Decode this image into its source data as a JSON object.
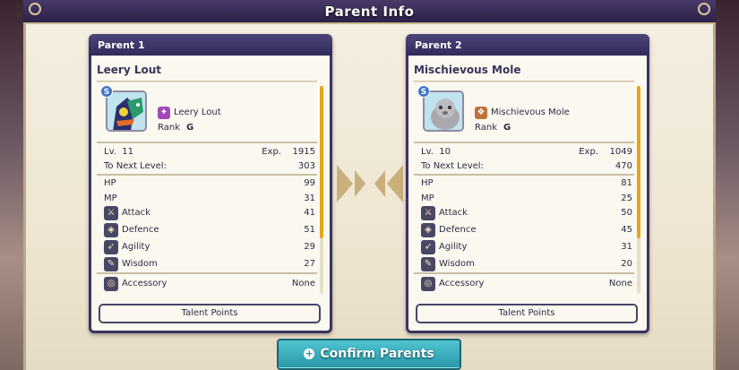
{
  "title": "Parent Info",
  "parents": [
    {
      "tab": "Parent 1",
      "name": "Leery Lout",
      "monster_name": "Leery Lout",
      "rank_label": "Rank",
      "rank": "G",
      "size_badge": "S",
      "family_icon": "demon-family-icon",
      "family_color": "#a04ab8",
      "lv_label": "Lv.",
      "lv": "11",
      "exp_label": "Exp.",
      "exp": "1915",
      "next_label": "To Next Level:",
      "next": "303",
      "hp_label": "HP",
      "hp": "99",
      "mp_label": "MP",
      "mp": "31",
      "attack_label": "Attack",
      "attack": "41",
      "defence_label": "Defence",
      "defence": "51",
      "agility_label": "Agility",
      "agility": "29",
      "wisdom_label": "Wisdom",
      "wisdom": "27",
      "accessory_label": "Accessory",
      "accessory": "None",
      "talent_button": "Talent Points"
    },
    {
      "tab": "Parent 2",
      "name": "Mischievous Mole",
      "monster_name": "Mischievous Mole",
      "rank_label": "Rank",
      "rank": "G",
      "size_badge": "S",
      "family_icon": "beast-family-icon",
      "family_color": "#c0703a",
      "lv_label": "Lv.",
      "lv": "10",
      "exp_label": "Exp.",
      "exp": "1049",
      "next_label": "To Next Level:",
      "next": "470",
      "hp_label": "HP",
      "hp": "81",
      "mp_label": "MP",
      "mp": "25",
      "attack_label": "Attack",
      "attack": "50",
      "defence_label": "Defence",
      "defence": "45",
      "agility_label": "Agility",
      "agility": "31",
      "wisdom_label": "Wisdom",
      "wisdom": "20",
      "accessory_label": "Accessory",
      "accessory": "None",
      "talent_button": "Talent Points"
    }
  ],
  "confirm_button": "Confirm Parents",
  "colors": {
    "accent": "#2897a8",
    "panel_header": "#332b5b",
    "scroll_thumb": "#e3a51c",
    "arrows": "#c9b07a"
  }
}
